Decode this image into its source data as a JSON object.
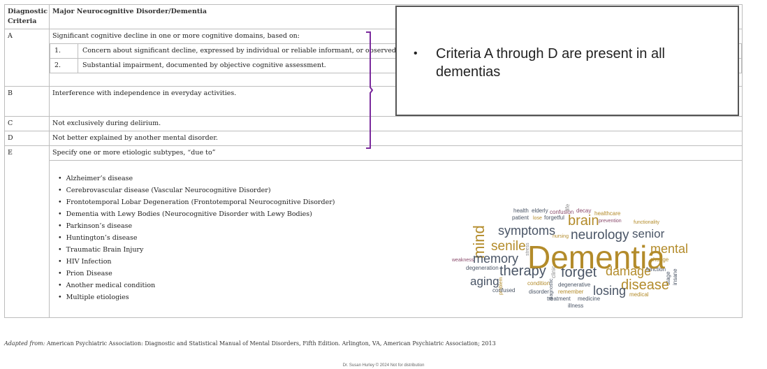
{
  "table": {
    "col_header": "Diagnostic Criteria",
    "col_title": "Major Neurocognitive Disorder/Dementia",
    "rows": [
      {
        "key": "A",
        "text": "Significant cognitive decline in one or more cognitive domains, based on:",
        "subs": [
          {
            "num": "1.",
            "text": "Concern about significant decline, expressed by individual or reliable informant, or observed by clinician."
          },
          {
            "num": "2.",
            "text": "Substantial impairment, documented by objective cognitive assessment."
          }
        ]
      },
      {
        "key": "B",
        "text": "Interference with independence in everyday activities."
      },
      {
        "key": "C",
        "text": "Not exclusively during delirium."
      },
      {
        "key": "D",
        "text": "Not better explained by another mental disorder."
      },
      {
        "key": "E",
        "text": "Specify one or more etiologic subtypes, “due to”"
      }
    ],
    "etiologies": [
      "Alzheimer’s disease",
      "Cerebrovascular disease (Vascular Neurocognitive Disorder)",
      "Frontotemporal Lobar Degeneration (Frontotemporal Neurocognitive Disorder)",
      "Dementia with Lewy Bodies (Neurocognitive Disorder with Lewy Bodies)",
      "Parkinson’s disease",
      "Huntington’s disease",
      "Traumatic Brain Injury",
      "HIV Infection",
      "Prion Disease",
      "Another medical condition",
      "Multiple etiologies"
    ]
  },
  "callout": {
    "bullet": "•",
    "text": "Criteria A through D are present in all dementias"
  },
  "source": {
    "prefix": "Adapted from:",
    "text": "American Psychiatric Association: Diagnostic and Statistical Manual of Mental Disorders, Fifth Edition. Arlington, VA, American Psychiatric Association; 2013"
  },
  "footer": "Dr. Susan Hurley © 2024 Not for distribution",
  "wordcloud": {
    "main": "Dementia",
    "words": [
      "life",
      "decay",
      "health",
      "elderly",
      "confusion",
      "healthcare",
      "patient",
      "lose",
      "forgetful",
      "brain",
      "prevention",
      "functionality",
      "symptoms",
      "nursing",
      "neurology",
      "senior",
      "mind",
      "senile",
      "stress",
      "mental",
      "change",
      "weakness",
      "memory",
      "degeneration",
      "therapy",
      "clinic",
      "forget",
      "damage",
      "function",
      "stage",
      "insane",
      "aging",
      "problem",
      "condition",
      "degenerative",
      "disease",
      "confused",
      "disorder",
      "diagnostic",
      "remember",
      "losing",
      "medical",
      "treatment",
      "medicine",
      "illness"
    ]
  },
  "colors": {
    "bracket": "#7a2a9c",
    "wc_gold": "#b38b2a",
    "wc_slate": "#4a5566",
    "wc_plum": "#8a4a6b",
    "wc_gray": "#8b8b8b"
  }
}
